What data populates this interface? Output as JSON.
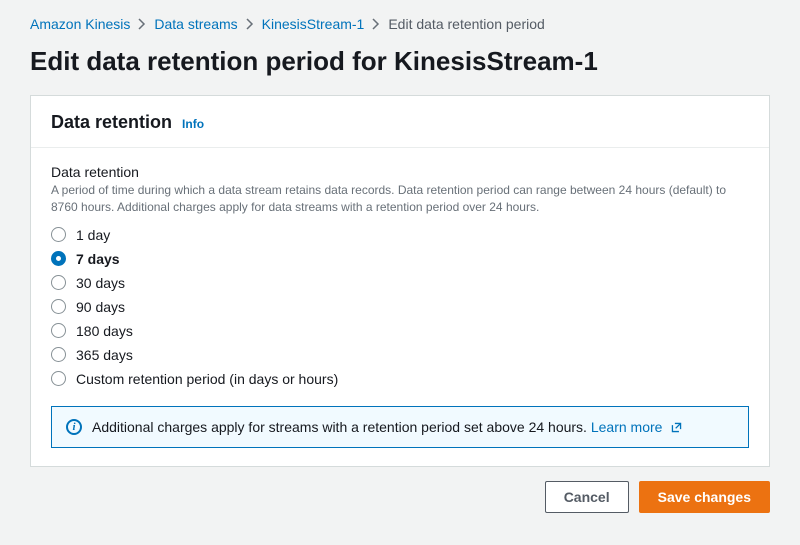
{
  "breadcrumbs": {
    "items": [
      {
        "label": "Amazon Kinesis"
      },
      {
        "label": "Data streams"
      },
      {
        "label": "KinesisStream-1"
      }
    ],
    "current": "Edit data retention period"
  },
  "page_title": "Edit data retention period for KinesisStream-1",
  "panel": {
    "title": "Data retention",
    "info_label": "Info",
    "field_label": "Data retention",
    "field_help": "A period of time during which a data stream retains data records. Data retention period can range between 24 hours (default) to 8760 hours. Additional charges apply for data streams with a retention period over 24 hours.",
    "options": [
      {
        "label": "1 day",
        "selected": false
      },
      {
        "label": "7 days",
        "selected": true
      },
      {
        "label": "30 days",
        "selected": false
      },
      {
        "label": "90 days",
        "selected": false
      },
      {
        "label": "180 days",
        "selected": false
      },
      {
        "label": "365 days",
        "selected": false
      },
      {
        "label": "Custom retention period (in days or hours)",
        "selected": false
      }
    ],
    "alert": {
      "text": "Additional charges apply for streams with a retention period set above 24 hours.",
      "learn_more": "Learn more"
    }
  },
  "actions": {
    "cancel": "Cancel",
    "save": "Save changes"
  }
}
